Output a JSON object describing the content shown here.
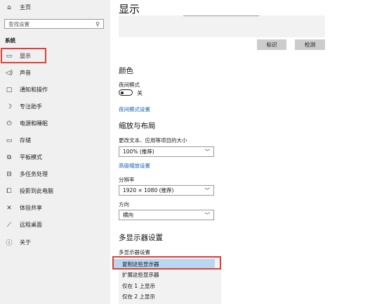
{
  "sidebar": {
    "home": "主页",
    "search_placeholder": "查找设置",
    "section": "系统",
    "items": [
      {
        "label": "显示",
        "icon": "monitor-icon"
      },
      {
        "label": "声音",
        "icon": "speaker-icon"
      },
      {
        "label": "通知和操作",
        "icon": "notification-icon"
      },
      {
        "label": "专注助手",
        "icon": "moon-icon"
      },
      {
        "label": "电源和睡眠",
        "icon": "power-icon"
      },
      {
        "label": "存储",
        "icon": "storage-icon"
      },
      {
        "label": "平板模式",
        "icon": "tablet-icon"
      },
      {
        "label": "多任务处理",
        "icon": "multitask-icon"
      },
      {
        "label": "投影到此电脑",
        "icon": "project-icon"
      },
      {
        "label": "体验共享",
        "icon": "share-icon"
      },
      {
        "label": "远程桌面",
        "icon": "remote-icon"
      },
      {
        "label": "关于",
        "icon": "info-icon"
      }
    ],
    "highlight_color": "#e0403a"
  },
  "main": {
    "title": "显示",
    "identify_button": "标识",
    "detect_button": "检测",
    "color_heading": "颜色",
    "night_mode_label": "夜间模式",
    "night_mode_state": "关",
    "night_mode_settings": "夜间模式设置",
    "scale_heading": "缩放与布局",
    "scale_label": "更改文本、应用等项目的大小",
    "scale_value": "100% (推荐)",
    "advanced_scaling": "高级缩放设置",
    "resolution_label": "分辨率",
    "resolution_value": "1920 × 1080 (推荐)",
    "orientation_label": "方向",
    "orientation_value": "横向",
    "multi_heading": "多显示器设置",
    "multi_label": "多显示器设置",
    "multi_options": [
      "复制这些显示器",
      "扩展这些显示器",
      "仅在 1 上显示",
      "仅在 2 上显示"
    ],
    "link_color": "#1a5fb4"
  }
}
